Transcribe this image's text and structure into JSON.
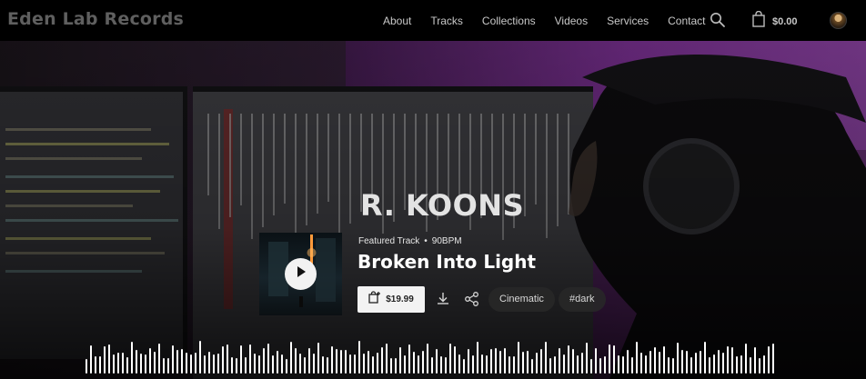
{
  "header": {
    "logo": "Eden Lab Records",
    "nav": [
      "About",
      "Tracks",
      "Collections",
      "Videos",
      "Services",
      "Contact"
    ],
    "search_icon": "search-icon",
    "cart_icon": "shopping-bag-icon",
    "cart_total": "$0.00"
  },
  "hero": {
    "artist": "R. KOONS",
    "featured_label": "Featured Track",
    "bullet": "•",
    "bpm": "90BPM",
    "title": "Broken Into Light",
    "price": "$19.99",
    "tags": [
      "Cinematic",
      "#dark"
    ],
    "icons": [
      "play-icon",
      "add-to-cart-icon",
      "download-icon",
      "share-icon"
    ]
  },
  "colors": {
    "accent_purple": "#6b2a80",
    "text_light": "#e3e3e3",
    "logo_gray": "#5f5f5f"
  }
}
